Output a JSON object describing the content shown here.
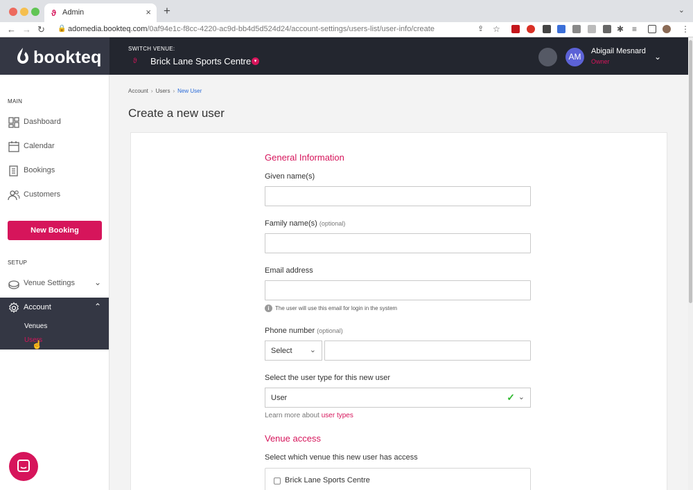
{
  "browser": {
    "tab_title": "Admin",
    "url_host": "adomedia.bookteq.com",
    "url_path": "/0af94e1c-f8cc-4220-ac9d-bb4d5d524d24/account-settings/users-list/user-info/create"
  },
  "header": {
    "brand": "bookteq",
    "switch_venue_label": "SWITCH VENUE:",
    "venue_name": "Brick Lane Sports Centre",
    "avatar_initials": "AM",
    "user_name": "Abigail Mesnard",
    "user_role": "Owner"
  },
  "sidebar": {
    "main_label": "MAIN",
    "items": [
      {
        "label": "Dashboard",
        "icon": "dashboard-icon"
      },
      {
        "label": "Calendar",
        "icon": "calendar-icon"
      },
      {
        "label": "Bookings",
        "icon": "bookings-icon"
      },
      {
        "label": "Customers",
        "icon": "customers-icon"
      }
    ],
    "new_booking": "New Booking",
    "setup_label": "SETUP",
    "venue_settings": "Venue Settings",
    "account": "Account",
    "account_sub": [
      "Venues",
      "Users"
    ]
  },
  "breadcrumb": [
    "Account",
    "Users",
    "New User"
  ],
  "page_title": "Create a new user",
  "form": {
    "general_heading": "General Information",
    "given_name_label": "Given name(s)",
    "family_name_label": "Family name(s)",
    "optional": "(optional)",
    "email_label": "Email address",
    "email_hint": "The user will use this email for login in the system",
    "phone_label": "Phone number",
    "phone_select": "Select",
    "user_type_label": "Select the user type for this new user",
    "user_type_value": "User",
    "learn_more": "Learn more about",
    "learn_link": "user types",
    "venue_heading": "Venue access",
    "venue_access_label": "Select which venue this new user has access",
    "venue_option": "Brick Lane Sports Centre"
  },
  "colors": {
    "accent": "#d6155b",
    "dark": "#23262f",
    "link": "#2b6cd9"
  }
}
